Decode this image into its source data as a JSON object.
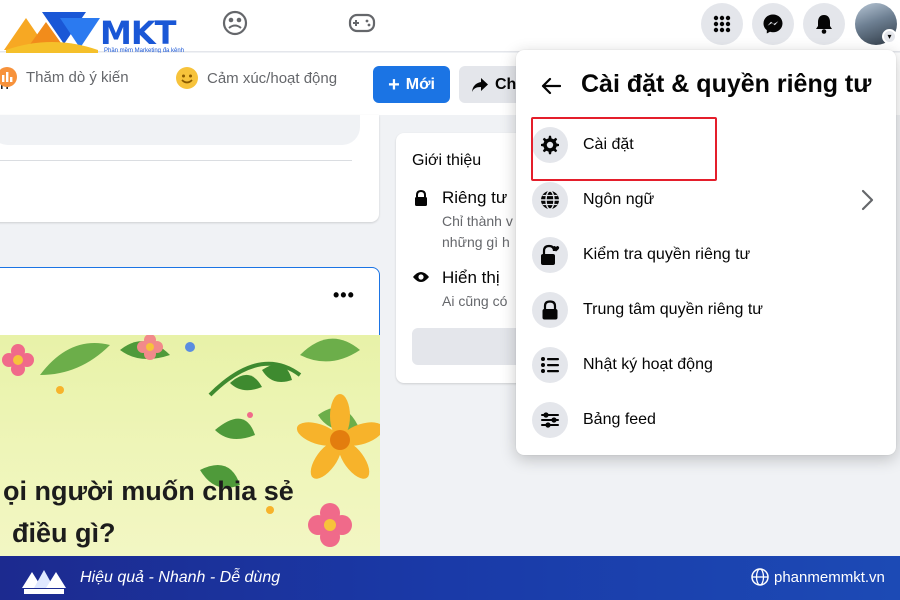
{
  "brand": {
    "logo_text": "MKT",
    "logo_subtitle": "Phần mềm Marketing đa kênh"
  },
  "subheader": {
    "partial_text": "h",
    "new_button_label": "Mới",
    "share_button_label": "Ch"
  },
  "composer": {
    "actions": [
      {
        "label": "Thăm dò ý kiến",
        "icon": "poll-icon"
      },
      {
        "label": "Cảm xúc/hoạt động",
        "icon": "smile-icon"
      }
    ]
  },
  "post": {
    "more_label": "•••",
    "text_lines": [
      "ọi người muốn chia sẻ",
      "điều gì?"
    ]
  },
  "intro": {
    "title": "Giới thiệu",
    "rows": [
      {
        "title": "Riêng tư",
        "sub_lines": [
          "Chỉ thành v",
          "những gì h"
        ],
        "icon": "lock-icon"
      },
      {
        "title": "Hiển thị",
        "sub_lines": [
          "Ai cũng có"
        ],
        "icon": "eye-icon"
      }
    ]
  },
  "dropdown": {
    "title": "Cài đặt & quyền riêng tư",
    "items": [
      {
        "label": "Cài đặt",
        "icon": "gear-icon",
        "has_chevron": false,
        "highlighted": true
      },
      {
        "label": "Ngôn ngữ",
        "icon": "globe-icon",
        "has_chevron": true,
        "highlighted": false
      },
      {
        "label": "Kiểm tra quyền riêng tư",
        "icon": "lock-heart-icon",
        "has_chevron": false,
        "highlighted": false
      },
      {
        "label": "Trung tâm quyền riêng tư",
        "icon": "lock-icon",
        "has_chevron": false,
        "highlighted": false
      },
      {
        "label": "Nhật ký hoạt động",
        "icon": "list-icon",
        "has_chevron": false,
        "highlighted": false
      },
      {
        "label": "Bảng feed",
        "icon": "sliders-icon",
        "has_chevron": false,
        "highlighted": false
      }
    ]
  },
  "footer": {
    "tagline": "Hiệu quả - Nhanh  - Dễ dùng",
    "website": "phanmemmkt.vn"
  },
  "colors": {
    "facebook_blue": "#1b74e4",
    "highlight_red": "#e41e2b",
    "footer_blue": "#1c2a8f"
  }
}
